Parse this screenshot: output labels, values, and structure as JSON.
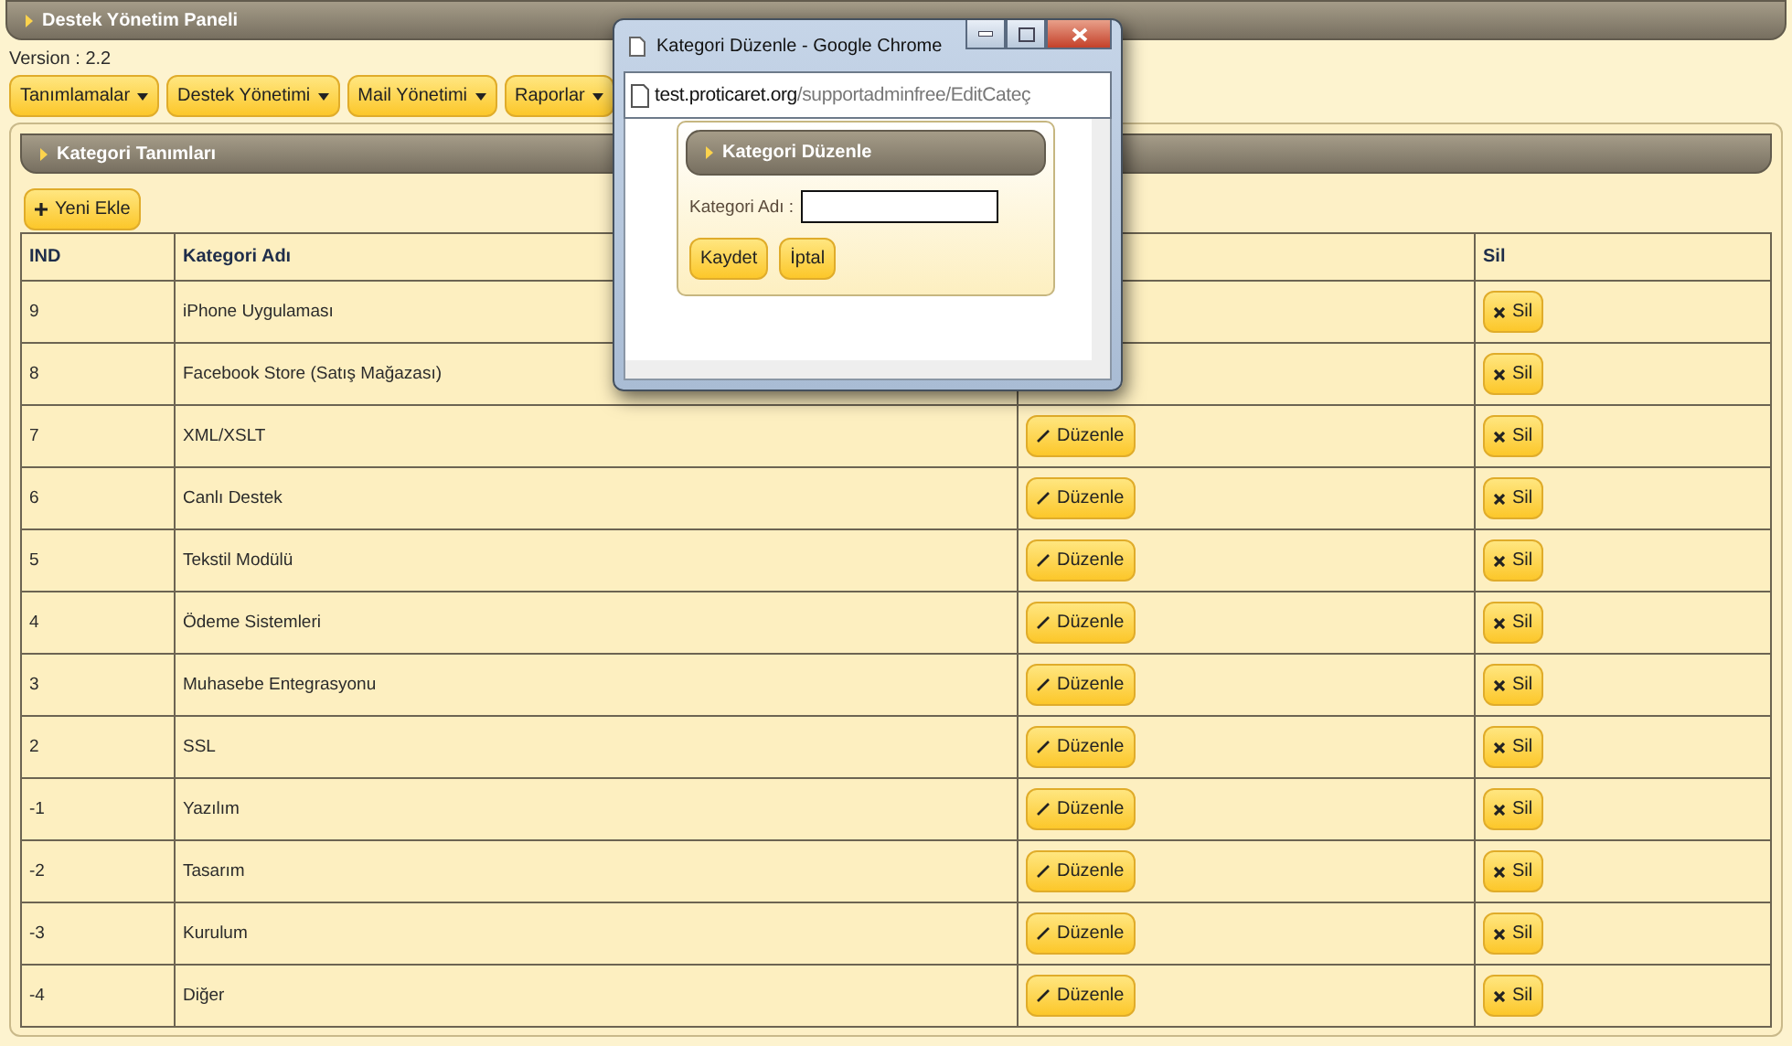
{
  "header": {
    "title": "Destek Yönetim Paneli"
  },
  "version": "Version : 2.2",
  "menu": [
    {
      "label": "Tanımlamalar"
    },
    {
      "label": "Destek Yönetimi"
    },
    {
      "label": "Mail Yönetimi"
    },
    {
      "label": "Raporlar"
    }
  ],
  "panel": {
    "title": "Kategori Tanımları",
    "add_button": "Yeni Ekle"
  },
  "table": {
    "columns": [
      "IND",
      "Kategori Adı",
      "Sil"
    ],
    "rows": [
      {
        "ind": "9",
        "name": "iPhone Uygulaması",
        "delete": "Sil"
      },
      {
        "ind": "8",
        "name": "Facebook Store (Satış Mağazası)",
        "delete": "Sil"
      },
      {
        "ind": "7",
        "name": "XML/XSLT",
        "edit": "Düzenle",
        "delete": "Sil"
      },
      {
        "ind": "6",
        "name": "Canlı Destek",
        "edit": "Düzenle",
        "delete": "Sil"
      },
      {
        "ind": "5",
        "name": "Tekstil Modülü",
        "edit": "Düzenle",
        "delete": "Sil"
      },
      {
        "ind": "4",
        "name": "Ödeme Sistemleri",
        "edit": "Düzenle",
        "delete": "Sil"
      },
      {
        "ind": "3",
        "name": "Muhasebe Entegrasyonu",
        "edit": "Düzenle",
        "delete": "Sil"
      },
      {
        "ind": "2",
        "name": "SSL",
        "edit": "Düzenle",
        "delete": "Sil"
      },
      {
        "ind": "-1",
        "name": "Yazılım",
        "edit": "Düzenle",
        "delete": "Sil"
      },
      {
        "ind": "-2",
        "name": "Tasarım",
        "edit": "Düzenle",
        "delete": "Sil"
      },
      {
        "ind": "-3",
        "name": "Kurulum",
        "edit": "Düzenle",
        "delete": "Sil"
      },
      {
        "ind": "-4",
        "name": "Diğer",
        "edit": "Düzenle",
        "delete": "Sil"
      }
    ]
  },
  "popup": {
    "title": "Kategori Düzenle - Google Chrome",
    "url_host": "test.proticaret.org",
    "url_path": "/supportadminfree/EditCateç",
    "form_title": "Kategori Düzenle",
    "field_label": "Kategori Adı :",
    "buttons": [
      "Kaydet",
      "İptal"
    ]
  }
}
